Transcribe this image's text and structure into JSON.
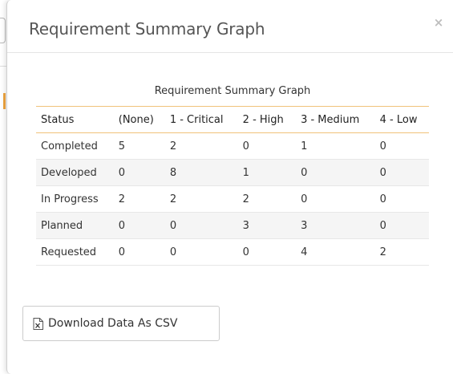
{
  "modal": {
    "title": "Requirement Summary Graph",
    "close_glyph": "×"
  },
  "table": {
    "caption": "Requirement Summary Graph",
    "headers": [
      "Status",
      "(None)",
      "1 - Critical",
      "2 - High",
      "3 - Medium",
      "4 - Low"
    ],
    "rows": [
      [
        "Completed",
        "5",
        "2",
        "0",
        "1",
        "0"
      ],
      [
        "Developed",
        "0",
        "8",
        "1",
        "0",
        "0"
      ],
      [
        "In Progress",
        "2",
        "2",
        "2",
        "0",
        "0"
      ],
      [
        "Planned",
        "0",
        "0",
        "3",
        "3",
        "0"
      ],
      [
        "Requested",
        "0",
        "0",
        "0",
        "4",
        "2"
      ]
    ],
    "header_border_color": "#f0c27a",
    "alt_row_color": "#f5f5f5"
  },
  "actions": {
    "download_csv_label": "Download Data As CSV",
    "download_icon": "excel-file-icon"
  }
}
